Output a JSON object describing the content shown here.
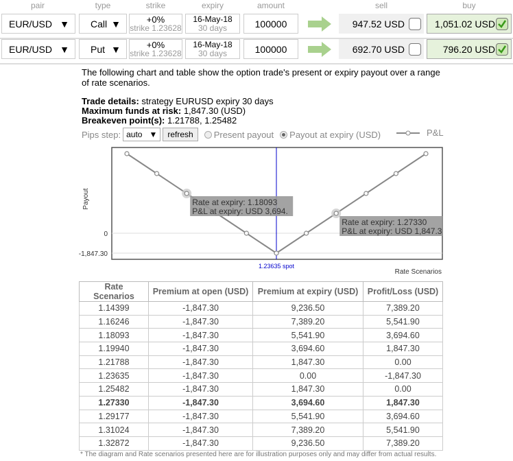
{
  "headers": {
    "pair": "pair",
    "type": "type",
    "strike": "strike",
    "expiry": "expiry",
    "amount": "amount",
    "sell": "sell",
    "buy": "buy"
  },
  "rows": [
    {
      "pair": "EUR/USD",
      "type": "Call",
      "strike_pct": "+0%",
      "strike": "strike 1.23628",
      "expiry_date": "16-May-18",
      "expiry_days": "30 days",
      "amount": "100000",
      "sell": "947.52 USD",
      "sell_checked": false,
      "buy": "1,051.02 USD",
      "buy_checked": true
    },
    {
      "pair": "EUR/USD",
      "type": "Put",
      "strike_pct": "+0%",
      "strike": "strike 1.23628",
      "expiry_date": "16-May-18",
      "expiry_days": "30 days",
      "amount": "100000",
      "sell": "692.70 USD",
      "sell_checked": false,
      "buy": "796.20 USD",
      "buy_checked": true
    }
  ],
  "intro": "The following chart and table show the option trade's present or expiry payout over a range of rate scenarios.",
  "details": {
    "trade_label": "Trade details:",
    "trade_value": " strategy EURUSD expiry 30 days",
    "funds_label": "Maximum funds at risk:",
    "funds_value": " 1,847.30 (USD)",
    "breakeven_label": "Breakeven point(s):",
    "breakeven_value": " 1.21788, 1.25482"
  },
  "options": {
    "pips_label": "Pips step:",
    "pips_value": "auto",
    "refresh": "refresh",
    "present": "Present payout",
    "expiry": "Payout at expiry (USD)",
    "selected": "expiry"
  },
  "colors": {
    "accent_arrow": "#a9d18e",
    "buy_bg": "#e6f2dc",
    "spot_line": "#0000cc"
  },
  "chart_data": {
    "type": "line",
    "ylabel": "Payout",
    "xlabel": "Rate Scenarios",
    "legend": "P&L",
    "legend_position": "top-right",
    "ytick_labels": [
      "0",
      "-1,847.30"
    ],
    "spot_label": "1.23635 spot",
    "spot": 1.23635,
    "x": [
      1.14399,
      1.16246,
      1.18093,
      1.1994,
      1.21788,
      1.23635,
      1.25482,
      1.2733,
      1.29177,
      1.31024,
      1.32872
    ],
    "series": [
      {
        "name": "P&L",
        "values": [
          7389.2,
          5541.9,
          3694.6,
          1847.3,
          0,
          -1847.3,
          0,
          1847.3,
          3694.6,
          5541.9,
          7389.2
        ]
      }
    ],
    "tooltips": [
      {
        "index": 2,
        "line1": "Rate at expiry: 1.18093",
        "line2": "P&L at expiry: USD 3,694."
      },
      {
        "index": 7,
        "line1": "Rate at expiry: 1.27330",
        "line2": "P&L at expiry: USD 1,847.3"
      }
    ],
    "grid": true
  },
  "table": {
    "headers": [
      "Rate Scenarios",
      "Premium at open (USD)",
      "Premium at expiry (USD)",
      "Profit/Loss (USD)"
    ],
    "rows": [
      [
        "1.14399",
        "-1,847.30",
        "9,236.50",
        "7,389.20"
      ],
      [
        "1.16246",
        "-1,847.30",
        "7,389.20",
        "5,541.90"
      ],
      [
        "1.18093",
        "-1,847.30",
        "5,541.90",
        "3,694.60"
      ],
      [
        "1.19940",
        "-1,847.30",
        "3,694.60",
        "1,847.30"
      ],
      [
        "1.21788",
        "-1,847.30",
        "1,847.30",
        "0.00"
      ],
      [
        "1.23635",
        "-1,847.30",
        "0.00",
        "-1,847.30"
      ],
      [
        "1.25482",
        "-1,847.30",
        "1,847.30",
        "0.00"
      ],
      [
        "1.27330",
        "-1,847.30",
        "3,694.60",
        "1,847.30"
      ],
      [
        "1.29177",
        "-1,847.30",
        "5,541.90",
        "3,694.60"
      ],
      [
        "1.31024",
        "-1,847.30",
        "7,389.20",
        "5,541.90"
      ],
      [
        "1.32872",
        "-1,847.30",
        "9,236.50",
        "7,389.20"
      ]
    ],
    "bold_row": 7
  },
  "footnote": "* The diagram and Rate scenarios presented here are for illustration purposes only and may differ from actual results."
}
